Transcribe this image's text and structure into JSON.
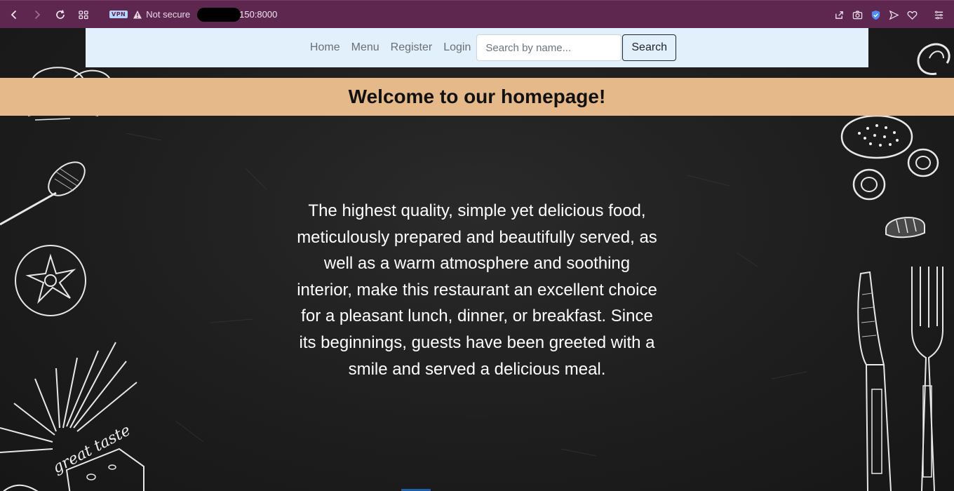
{
  "browser": {
    "vpn_label": "VPN",
    "security_text": "Not secure",
    "url_visible": "150:8000",
    "icons": [
      "back-icon",
      "forward-icon",
      "reload-icon",
      "tabs-grid-icon",
      "warning-icon",
      "share-icon",
      "camera-icon",
      "shield-icon",
      "send-icon",
      "heart-icon",
      "menu-icon"
    ],
    "theme_color": "#5e2750"
  },
  "navbar": {
    "links": [
      "Home",
      "Menu",
      "Register",
      "Login"
    ],
    "search": {
      "placeholder": "Search by name...",
      "value": "",
      "button_label": "Search"
    },
    "background": "#e2f0fc"
  },
  "hero": {
    "title": "Welcome to our homepage!",
    "banner_color": "#e6b98a",
    "intro": "The highest quality, simple yet delicious food, meticulously prepared and beautifully served, as well as a warm atmosphere and soothing interior, make this restaurant an excellent choice for a pleasant lunch, dinner, or breakfast. Since its beginnings, guests have been greeted with a smile and served a delicious meal."
  },
  "decorations": {
    "badge_text": "great taste",
    "icons": [
      "spoon-icon",
      "tomato-icon",
      "cheese-icon",
      "burger-bun-icon",
      "onion-ring-icon",
      "bread-icon",
      "knife-icon",
      "fork-icon",
      "chili-icon"
    ]
  }
}
